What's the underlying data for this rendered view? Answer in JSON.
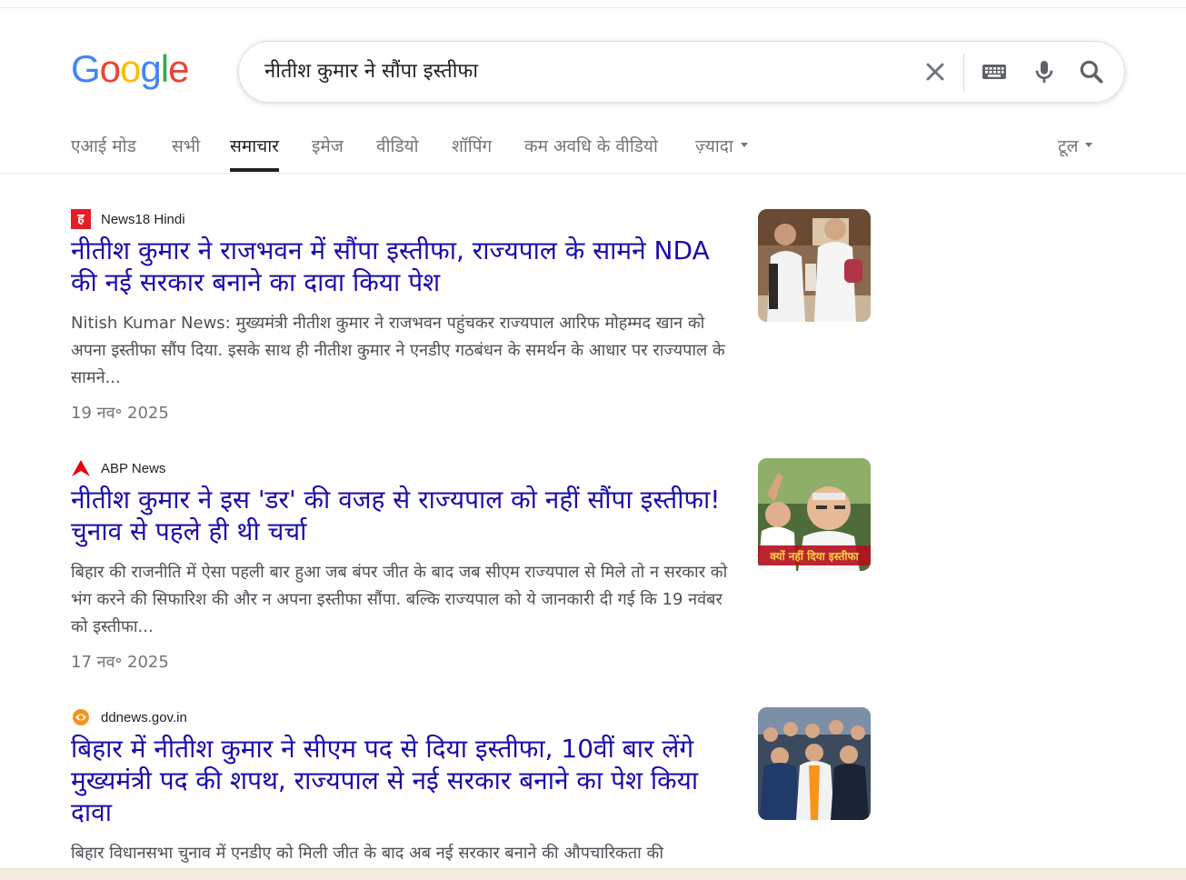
{
  "logo": {
    "letters": [
      "G",
      "o",
      "o",
      "g",
      "l",
      "e"
    ]
  },
  "search": {
    "query": "नीतीश कुमार ने सौंपा इस्तीफा"
  },
  "tabs": [
    {
      "label": "एआई मोड"
    },
    {
      "label": "सभी"
    },
    {
      "label": "समाचार",
      "active": true
    },
    {
      "label": "इमेज"
    },
    {
      "label": "वीडियो"
    },
    {
      "label": "शॉपिंग"
    },
    {
      "label": "कम अवधि के वीडियो"
    },
    {
      "label": "ज़्यादा"
    }
  ],
  "tools_label": "टूल",
  "results": [
    {
      "source": "News18 Hindi",
      "favicon_letter": "ह",
      "title": "नीतीश कुमार ने राजभवन में सौंपा इस्तीफा, राज्यपाल के सामने NDA की नई सरकार बनाने का दावा किया पेश",
      "snippet": "Nitish Kumar News: मुख्यमंत्री नीतीश कुमार ने राजभवन पहुंचकर राज्यपाल आरिफ मोहम्मद खान को अपना इस्तीफा सौंप दिया. इसके साथ ही नीतीश कुमार ने एनडीए गठबंधन के समर्थन के आधार पर राज्यपाल के सामने...",
      "date": "19 नव॰ 2025"
    },
    {
      "source": "ABP News",
      "title": "नीतीश कुमार ने इस 'डर' की वजह से राज्यपाल को नहीं सौंपा इस्तीफा! चुनाव से पहले ही थी चर्चा",
      "snippet": "बिहार की राजनीति में ऐसा पहली बार हुआ जब बंपर जीत के बाद जब सीएम राज्यपाल से मिले तो न सरकार को भंग करने की सिफारिश की और न अपना इस्तीफा सौंपा. बल्कि राज्यपाल को ये जानकारी दी गई कि 19 नवंबर को इस्तीफा...",
      "date": "17 नव॰ 2025",
      "thumb_caption": "क्यों नहीं दिया इस्तीफा"
    },
    {
      "source": "ddnews.gov.in",
      "title": "बिहार में नीतीश कुमार ने सीएम पद से दिया इस्तीफा, 10वीं बार लेंगे मुख्यमंत्री पद की शपथ, राज्यपाल से नई सरकार बनाने का पेश किया दावा",
      "snippet": "बिहार विधानसभा चुनाव में एनडीए को मिली जीत के बाद अब नई सरकार बनाने की औपचारिकता की"
    }
  ],
  "colors": {
    "link": "#1a0dab",
    "snippet": "#4d5156",
    "meta": "#70757a"
  }
}
